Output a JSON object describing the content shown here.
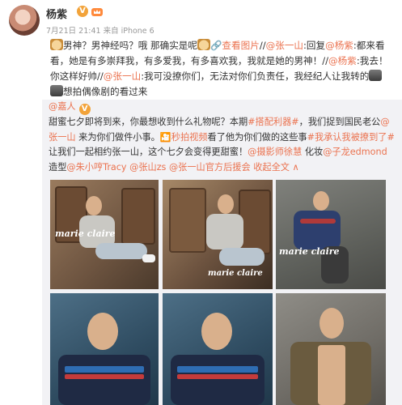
{
  "post": {
    "username": "杨紫",
    "badge": "V",
    "date": "7月21日 21:41",
    "source": "来自 iPhone 6",
    "segments": [
      {
        "t": "icon",
        "name": "emoji-cat-icon"
      },
      {
        "t": "text",
        "v": "男神？男神经吗？哦 那确实是呢"
      },
      {
        "t": "icon",
        "name": "emoji-cat-icon"
      },
      {
        "t": "link",
        "v": "🔗查看图片"
      },
      {
        "t": "text",
        "v": "//"
      },
      {
        "t": "link",
        "v": "@张一山"
      },
      {
        "t": "text",
        "v": ":回复"
      },
      {
        "t": "link",
        "v": "@杨紫"
      },
      {
        "t": "text",
        "v": ":都来看看，她是有多崇拜我，有多爱我，有多喜欢我，我就是她的男神！//"
      },
      {
        "t": "link",
        "v": "@杨紫"
      },
      {
        "t": "text",
        "v": ":我去！你这样好帅//"
      },
      {
        "t": "link",
        "v": "@张一山"
      },
      {
        "t": "text",
        "v": ":我可没撩你们，无法对你们负责任，我经纪人让我转的"
      },
      {
        "t": "icon",
        "name": "emoji-camera-icon"
      },
      {
        "t": "icon",
        "name": "emoji-camera-icon"
      },
      {
        "t": "text",
        "v": "想拍偶像剧的看过来"
      }
    ]
  },
  "repost": {
    "segments": [
      {
        "t": "link",
        "v": "@嘉人"
      },
      {
        "t": "icon",
        "name": "verified-icon"
      },
      {
        "t": "br"
      },
      {
        "t": "text",
        "v": "甜蜜七夕即将到来，你最想收到什么礼物呢？本期"
      },
      {
        "t": "link",
        "v": "#搭配利器#"
      },
      {
        "t": "text",
        "v": "，我们捉到国民老公"
      },
      {
        "t": "link",
        "v": "@张一山"
      },
      {
        "t": "text",
        "v": " 来为你们做件小事。"
      },
      {
        "t": "link",
        "v": "🎦秒拍视频"
      },
      {
        "t": "text",
        "v": "看了他为你们做的这些事"
      },
      {
        "t": "link",
        "v": "#我承认我被撩到了#"
      },
      {
        "t": "text",
        "v": "让我们一起相约张一山，这个七夕会变得更甜蜜！"
      },
      {
        "t": "link",
        "v": "@摄影师徐慧"
      },
      {
        "t": "text",
        "v": " 化妆"
      },
      {
        "t": "link",
        "v": "@子龙edmond"
      },
      {
        "t": "text",
        "v": " 造型"
      },
      {
        "t": "link",
        "v": "@朱小哼Tracy"
      },
      {
        "t": "text",
        "v": " "
      },
      {
        "t": "link",
        "v": "@张山zs"
      },
      {
        "t": "text",
        "v": " "
      },
      {
        "t": "link",
        "v": "@张一山官方后援会"
      },
      {
        "t": "text",
        "v": " "
      },
      {
        "t": "link",
        "v": "收起全文 ∧"
      }
    ],
    "watermark": "marie claire",
    "watermark_url": "www.marieclaire.com.cn",
    "photos": [
      "p1",
      "p2",
      "p3",
      "p4",
      "p5",
      "p6"
    ]
  },
  "colors": {
    "link": "#eb7350",
    "repost_bg": "#f2f2f5",
    "meta": "#999999",
    "badge": "#f2a33a"
  }
}
